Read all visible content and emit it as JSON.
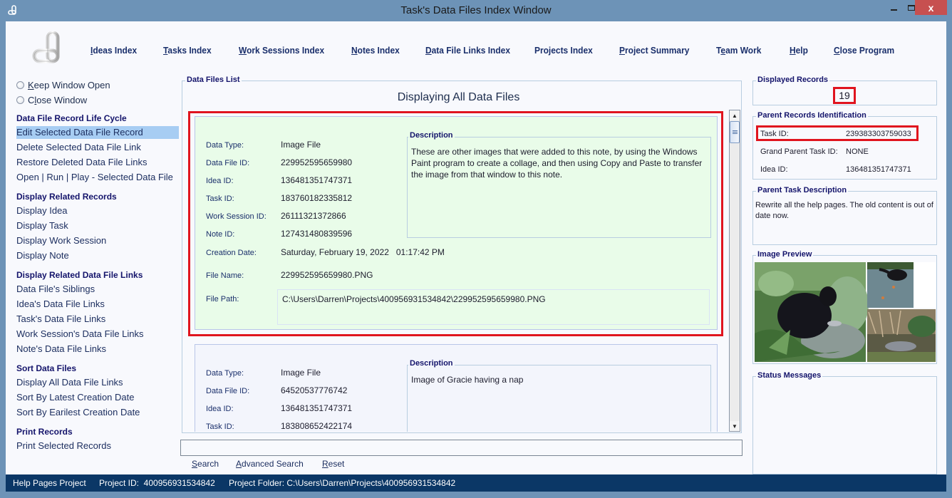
{
  "window": {
    "title": "Task's Data Files Index Window",
    "minimize_icon": "minimize-icon",
    "maximize_icon": "maximize-icon",
    "close_icon": "close-icon",
    "close_glyph": "x"
  },
  "topnav": {
    "items": [
      {
        "pre": "",
        "u": "I",
        "post": "deas Index"
      },
      {
        "pre": "",
        "u": "T",
        "post": "asks Index"
      },
      {
        "pre": "",
        "u": "W",
        "post": "ork Sessions Index"
      },
      {
        "pre": "",
        "u": "N",
        "post": "otes Index"
      },
      {
        "pre": "",
        "u": "D",
        "post": "ata File Links Index"
      },
      {
        "pre": "Projects Index",
        "u": "",
        "post": ""
      },
      {
        "pre": "",
        "u": "P",
        "post": "roject Summary"
      },
      {
        "pre": "T",
        "u": "e",
        "post": "am Work"
      },
      {
        "pre": "",
        "u": "H",
        "post": "elp"
      },
      {
        "pre": "",
        "u": "C",
        "post": "lose Program"
      }
    ]
  },
  "sidebar": {
    "radios": [
      {
        "pre": "",
        "u": "K",
        "post": "eep Window Open"
      },
      {
        "pre": "C",
        "u": "l",
        "post": "ose Window"
      }
    ],
    "sections": [
      {
        "title": "Data File Record Life Cycle",
        "items": [
          "Edit Selected Data File Record",
          "Delete Selected Data File Link",
          "Restore Deleted Data File Links",
          "Open | Run | Play - Selected Data File"
        ]
      },
      {
        "title": "Display Related Records",
        "items": [
          "Display Idea",
          "Display Task",
          "Display Work Session",
          "Display Note"
        ]
      },
      {
        "title": "Display Related Data File Links",
        "items": [
          "Data File's Siblings",
          "Idea's Data File Links",
          "Task's Data File Links",
          "Work Session's Data File Links",
          "Note's Data File Links"
        ]
      },
      {
        "title": "Sort Data Files",
        "items": [
          "Display All Data File Links",
          "Sort By Latest Creation Date",
          "Sort By Earilest Creation Date"
        ]
      },
      {
        "title": "Print Records",
        "items": [
          "Print Selected Records"
        ]
      }
    ],
    "selected_item": "Edit Selected Data File Record"
  },
  "list": {
    "legend": "Data Files List",
    "title": "Displaying All Data Files",
    "labels": {
      "data_type": "Data Type:",
      "data_file_id": "Data File ID:",
      "idea_id": "Idea ID:",
      "task_id": "Task ID:",
      "work_session_id": "Work Session ID:",
      "note_id": "Note ID:",
      "creation_date": "Creation Date:",
      "file_name": "File Name:",
      "file_path": "File Path:",
      "description": "Description"
    },
    "records": [
      {
        "data_type": "Image File",
        "data_file_id": "229952595659980",
        "idea_id": "136481351747371",
        "task_id": "183760182335812",
        "work_session_id": "26111321372866",
        "note_id": "127431480839596",
        "creation_date": "Saturday, February 19, 2022   01:17:42 PM",
        "file_name": "229952595659980.PNG",
        "file_path": "C:\\Users\\Darren\\Projects\\400956931534842\\229952595659980.PNG",
        "description": "These are other images that were added to this note, by using the Windows Paint program to create a collage, and then using Copy and Paste to transfer the image from that window to this note.",
        "selected": true
      },
      {
        "data_type": "Image File",
        "data_file_id": "64520537776742",
        "idea_id": "136481351747371",
        "task_id": "183808652422174",
        "description": "Image of Gracie having a nap",
        "selected": false
      }
    ],
    "scrollbar": {
      "position_fraction": 0.0
    }
  },
  "search": {
    "value": "",
    "placeholder": "",
    "links": [
      {
        "u": "S",
        "post": "earch"
      },
      {
        "u": "A",
        "post": "dvanced Search"
      },
      {
        "u": "R",
        "post": "eset"
      }
    ]
  },
  "right": {
    "displayed_records": {
      "legend": "Displayed Records",
      "count": "19"
    },
    "parent_ids": {
      "legend": "Parent Records Identification",
      "rows": [
        {
          "label": "Task ID:",
          "value": "239383303759033"
        },
        {
          "label": "Grand Parent Task ID:",
          "value": "NONE"
        },
        {
          "label": "Idea ID:",
          "value": "136481351747371"
        }
      ]
    },
    "parent_desc": {
      "legend": "Parent Task Description",
      "text": "Rewrite all the help pages. The old content is out of date now."
    },
    "image_preview": {
      "legend": "Image Preview",
      "alt": "Collage of a black bear, a small dark animal on a rock, and an opossum"
    },
    "status": {
      "legend": "Status Messages",
      "text": ""
    }
  },
  "statusbar": {
    "project": "Help Pages Project",
    "project_id": "Project ID:  400956931534842",
    "project_folder": "Project Folder: C:\\Users\\Darren\\Projects\\400956931534842"
  }
}
